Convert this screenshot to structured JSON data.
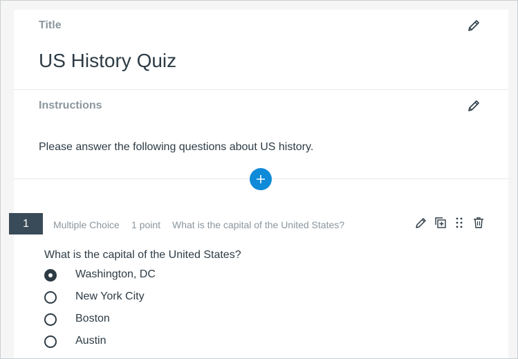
{
  "title_section": {
    "label": "Title",
    "value": "US History Quiz"
  },
  "instructions_section": {
    "label": "Instructions",
    "value": "Please answer the following questions about US history."
  },
  "add_button": {
    "icon": "plus-icon",
    "color": "#0f8ad8"
  },
  "question": {
    "number": "1",
    "type": "Multiple Choice",
    "points": "1 point",
    "preview": "What is the capital of the United States?",
    "text": "What is the capital of the United States?",
    "actions": [
      "pencil-icon",
      "duplicate-icon",
      "drag-handle-icon",
      "trash-icon"
    ],
    "answers": [
      {
        "label": "Washington, DC",
        "selected": true
      },
      {
        "label": "New York City",
        "selected": false
      },
      {
        "label": "Boston",
        "selected": false
      },
      {
        "label": "Austin",
        "selected": false
      }
    ]
  },
  "colors": {
    "accent": "#0f8ad8",
    "number_badge": "#394b58",
    "muted_text": "#8b969e"
  }
}
